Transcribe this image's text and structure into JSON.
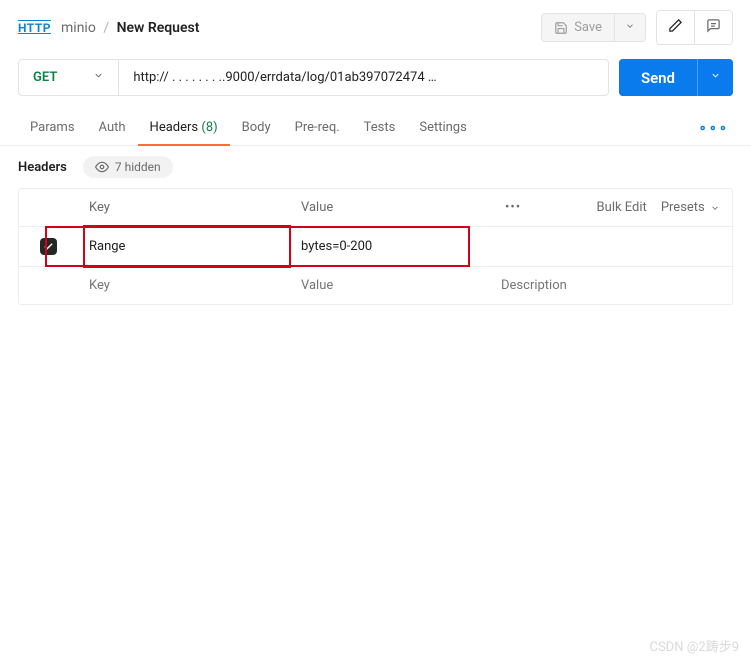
{
  "breadcrumb": {
    "workspace": "minio",
    "title": "New Request"
  },
  "toolbar": {
    "save_label": "Save"
  },
  "request": {
    "method": "GET",
    "url": "http:// . . . . . . . ..9000/errdata/log/01ab397072474 …",
    "send_label": "Send"
  },
  "tabs": {
    "params": "Params",
    "auth": "Auth",
    "headers": "Headers",
    "headers_count": "(8)",
    "body": "Body",
    "prereq": "Pre-req.",
    "tests": "Tests",
    "settings": "Settings"
  },
  "headers_section": {
    "title": "Headers",
    "hidden_label": "7 hidden",
    "columns": {
      "key": "Key",
      "value": "Value"
    },
    "actions": {
      "bulk_edit": "Bulk Edit",
      "presets": "Presets"
    },
    "rows": [
      {
        "checked": true,
        "key": "Range",
        "value": "bytes=0-200"
      }
    ],
    "placeholders": {
      "key": "Key",
      "value": "Value",
      "description": "Description"
    }
  },
  "watermark": "CSDN @2踌步9"
}
